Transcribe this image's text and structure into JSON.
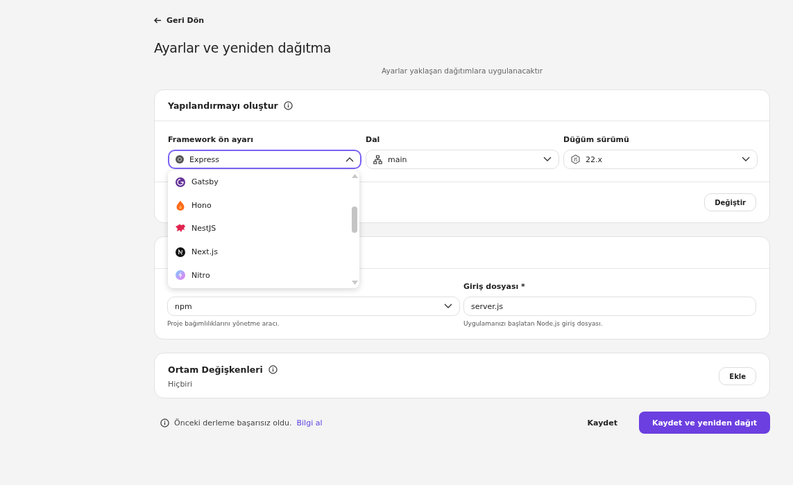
{
  "back_link": "Geri Dön",
  "title": "Ayarlar ve yeniden dağıtma",
  "subtitle": "Ayarlar yaklaşan dağıtımlara uygulanacaktır",
  "build_card": {
    "title": "Yapılandırmayı oluştur",
    "fields": [
      {
        "label": "Framework ön ayarı",
        "value": "Express",
        "kind": "framework",
        "expanded": true
      },
      {
        "label": "Dal",
        "value": "main",
        "kind": "branch",
        "expanded": false
      },
      {
        "label": "Düğüm sürümü",
        "value": "22.x",
        "kind": "node",
        "expanded": false
      }
    ],
    "dropdown": [
      {
        "label": "Gatsby",
        "kind": "gatsby"
      },
      {
        "label": "Hono",
        "kind": "hono"
      },
      {
        "label": "NestJS",
        "kind": "nest"
      },
      {
        "label": "Next.js",
        "kind": "next"
      },
      {
        "label": "Nitro",
        "kind": "nitro"
      }
    ],
    "change_button": "Değiştir"
  },
  "package_card": {
    "fields": [
      {
        "value": "npm",
        "kind": "select",
        "help": "Proje bağımlılıklarını yönetme aracı."
      },
      {
        "label": "Giriş dosyası *",
        "value": "server.js",
        "kind": "text",
        "help": "Uygulamanızı başlatan Node.js giriş dosyası."
      }
    ]
  },
  "env_card": {
    "title": "Ortam Değişkenleri",
    "value": "Hiçbiri",
    "add_button": "Ekle"
  },
  "footer": {
    "message": "Önceki derleme başarısız oldu.",
    "link": "Bilgi al",
    "save_button": "Kaydet",
    "deploy_button": "Kaydet ve yeniden dağıt"
  }
}
